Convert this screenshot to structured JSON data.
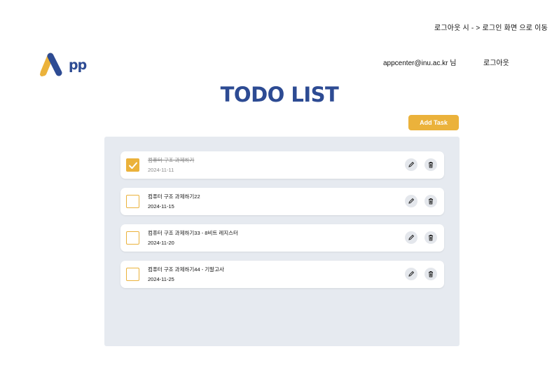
{
  "header": {
    "top_note": "로그아웃 시 - >  로그인 화면 으로 이동",
    "logo_text": "pp",
    "user_email": "appcenter@inu.ac.kr 님",
    "logout_label": "로그아웃"
  },
  "main": {
    "title": "TODO LIST",
    "add_task_label": "Add Task"
  },
  "tasks": [
    {
      "title": "컴퓨터 구조 과제하기",
      "date": "2024-11-11",
      "done": true
    },
    {
      "title": "컴퓨터 구조 과제하기22",
      "date": "2024-11-15",
      "done": false
    },
    {
      "title": "컴퓨터 구조 과제하기33 - 8비트 레지스터",
      "date": "2024-11-20",
      "done": false
    },
    {
      "title": "컴퓨터 구조 과제하기44 - 기말고사",
      "date": "2024-11-25",
      "done": false
    }
  ],
  "colors": {
    "accent": "#ebb23b",
    "brand": "#2d4b93",
    "panel": "#e6eaf0"
  },
  "icons": {
    "edit": "pencil-icon",
    "delete": "trash-icon",
    "check": "check-icon"
  }
}
